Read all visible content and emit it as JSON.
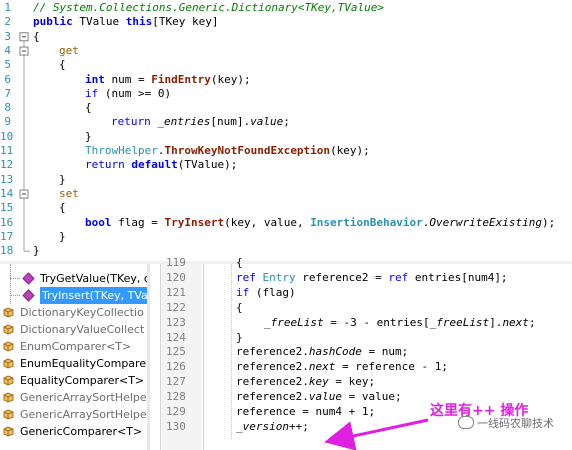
{
  "top_editor": {
    "lines": [
      {
        "n": "1",
        "tokens": [
          {
            "t": "// System.Collections.Generic.Dictionary<TKey,TValue>",
            "c": "c"
          }
        ],
        "indent": 0
      },
      {
        "n": "2",
        "tokens": [
          {
            "t": "public ",
            "c": "kb"
          },
          {
            "t": "TValue ",
            "c": ""
          },
          {
            "t": "this",
            "c": "kb"
          },
          {
            "t": "[TKey key]",
            "c": ""
          }
        ],
        "indent": 0
      },
      {
        "n": "3",
        "tokens": [
          {
            "t": "{",
            "c": ""
          }
        ],
        "indent": 0
      },
      {
        "n": "4",
        "tokens": [
          {
            "t": "get",
            "c": "kw2"
          }
        ],
        "indent": 1
      },
      {
        "n": "5",
        "tokens": [
          {
            "t": "{",
            "c": ""
          }
        ],
        "indent": 1
      },
      {
        "n": "6",
        "tokens": [
          {
            "t": "int ",
            "c": "kb"
          },
          {
            "t": "num = ",
            "c": ""
          },
          {
            "t": "FindEntry",
            "c": "m"
          },
          {
            "t": "(key);",
            "c": ""
          }
        ],
        "indent": 2
      },
      {
        "n": "7",
        "tokens": [
          {
            "t": "if ",
            "c": "k"
          },
          {
            "t": "(num >= 0)",
            "c": ""
          }
        ],
        "indent": 2
      },
      {
        "n": "8",
        "tokens": [
          {
            "t": "{",
            "c": ""
          }
        ],
        "indent": 2
      },
      {
        "n": "9",
        "tokens": [
          {
            "t": "return ",
            "c": "k"
          },
          {
            "t": "_entries",
            "c": "fld"
          },
          {
            "t": "[num].",
            "c": ""
          },
          {
            "t": "value",
            "c": "fld"
          },
          {
            "t": ";",
            "c": ""
          }
        ],
        "indent": 3
      },
      {
        "n": "10",
        "tokens": [
          {
            "t": "}",
            "c": ""
          }
        ],
        "indent": 2
      },
      {
        "n": "11",
        "tokens": [
          {
            "t": "ThrowHelper",
            "c": "cls"
          },
          {
            "t": ".",
            "c": ""
          },
          {
            "t": "ThrowKeyNotFoundException",
            "c": "m"
          },
          {
            "t": "(key);",
            "c": ""
          }
        ],
        "indent": 2
      },
      {
        "n": "12",
        "tokens": [
          {
            "t": "return ",
            "c": "k"
          },
          {
            "t": "default",
            "c": "kb"
          },
          {
            "t": "(TValue);",
            "c": ""
          }
        ],
        "indent": 2
      },
      {
        "n": "13",
        "tokens": [
          {
            "t": "}",
            "c": ""
          }
        ],
        "indent": 1
      },
      {
        "n": "14",
        "tokens": [
          {
            "t": "set",
            "c": "kw2"
          }
        ],
        "indent": 1
      },
      {
        "n": "15",
        "tokens": [
          {
            "t": "{",
            "c": ""
          }
        ],
        "indent": 1
      },
      {
        "n": "16",
        "tokens": [
          {
            "t": "bool ",
            "c": "kb"
          },
          {
            "t": "flag = ",
            "c": ""
          },
          {
            "t": "TryInsert",
            "c": "m"
          },
          {
            "t": "(key, value, ",
            "c": ""
          },
          {
            "t": "InsertionBehavior",
            "c": "en"
          },
          {
            "t": ".",
            "c": ""
          },
          {
            "t": "OverwriteExisting",
            "c": "fld"
          },
          {
            "t": ");",
            "c": ""
          }
        ],
        "indent": 2
      },
      {
        "n": "17",
        "tokens": [
          {
            "t": "}",
            "c": ""
          }
        ],
        "indent": 1
      },
      {
        "n": "18",
        "tokens": [
          {
            "t": "}",
            "c": ""
          }
        ],
        "indent": 0
      }
    ]
  },
  "tree": {
    "items": [
      {
        "label": "TryGetValue(TKey, o",
        "grey": false,
        "indent": 1,
        "selected": false,
        "icon": "method-icon"
      },
      {
        "label": "TryInsert(TKey, TVal",
        "grey": false,
        "indent": 1,
        "selected": true,
        "icon": "method-icon"
      },
      {
        "label": "DictionaryKeyCollectio",
        "grey": true,
        "indent": 0,
        "selected": false,
        "icon": "class-icon"
      },
      {
        "label": "DictionaryValueCollect",
        "grey": true,
        "indent": 0,
        "selected": false,
        "icon": "class-icon"
      },
      {
        "label": "EnumComparer<T>",
        "grey": true,
        "indent": 0,
        "selected": false,
        "icon": "class-icon"
      },
      {
        "label": "EnumEqualityCompare",
        "grey": false,
        "indent": 0,
        "selected": false,
        "icon": "class-icon"
      },
      {
        "label": "EqualityComparer<T>",
        "grey": false,
        "indent": 0,
        "selected": false,
        "icon": "class-icon"
      },
      {
        "label": "GenericArraySortHelpe",
        "grey": true,
        "indent": 0,
        "selected": false,
        "icon": "class-icon"
      },
      {
        "label": "GenericArraySortHelpe",
        "grey": true,
        "indent": 0,
        "selected": false,
        "icon": "class-icon"
      },
      {
        "label": "GenericComparer<T>",
        "grey": false,
        "indent": 0,
        "selected": false,
        "icon": "class-icon"
      }
    ]
  },
  "bottom_editor": {
    "lines": [
      {
        "n": "119",
        "tokens": [
          {
            "t": "{",
            "c": ""
          }
        ],
        "indent": 1
      },
      {
        "n": "120",
        "tokens": [
          {
            "t": "ref ",
            "c": "k"
          },
          {
            "t": "Entry ",
            "c": "cls"
          },
          {
            "t": "reference2 = ",
            "c": ""
          },
          {
            "t": "ref ",
            "c": "k"
          },
          {
            "t": "entries[num4];",
            "c": ""
          }
        ],
        "indent": 1
      },
      {
        "n": "121",
        "tokens": [
          {
            "t": "if ",
            "c": "k"
          },
          {
            "t": "(flag)",
            "c": ""
          }
        ],
        "indent": 1
      },
      {
        "n": "122",
        "tokens": [
          {
            "t": "{",
            "c": ""
          }
        ],
        "indent": 1
      },
      {
        "n": "123",
        "tokens": [
          {
            "t": "_freeList",
            "c": "fld"
          },
          {
            "t": " = -3 - entries[",
            "c": ""
          },
          {
            "t": "_freeList",
            "c": "fld"
          },
          {
            "t": "].",
            "c": ""
          },
          {
            "t": "next",
            "c": "fld"
          },
          {
            "t": ";",
            "c": ""
          }
        ],
        "indent": 2
      },
      {
        "n": "124",
        "tokens": [
          {
            "t": "}",
            "c": ""
          }
        ],
        "indent": 1
      },
      {
        "n": "125",
        "tokens": [
          {
            "t": "reference2.",
            "c": ""
          },
          {
            "t": "hashCode",
            "c": "fld"
          },
          {
            "t": " = num;",
            "c": ""
          }
        ],
        "indent": 1
      },
      {
        "n": "126",
        "tokens": [
          {
            "t": "reference2.",
            "c": ""
          },
          {
            "t": "next",
            "c": "fld"
          },
          {
            "t": " = reference - 1;",
            "c": ""
          }
        ],
        "indent": 1
      },
      {
        "n": "127",
        "tokens": [
          {
            "t": "reference2.",
            "c": ""
          },
          {
            "t": "key",
            "c": "fld"
          },
          {
            "t": " = key;",
            "c": ""
          }
        ],
        "indent": 1
      },
      {
        "n": "128",
        "tokens": [
          {
            "t": "reference2.",
            "c": ""
          },
          {
            "t": "value",
            "c": "fld"
          },
          {
            "t": " = value;",
            "c": ""
          }
        ],
        "indent": 1
      },
      {
        "n": "129",
        "tokens": [
          {
            "t": "reference = num4 + 1;",
            "c": ""
          }
        ],
        "indent": 1
      },
      {
        "n": "130",
        "tokens": [
          {
            "t": "_version",
            "c": "fld"
          },
          {
            "t": "++;",
            "c": ""
          }
        ],
        "indent": 1
      }
    ]
  },
  "annotation": {
    "text": "这里有++ 操作",
    "color": "#e020e0"
  },
  "watermark": {
    "text": "一线码农聊技术"
  }
}
